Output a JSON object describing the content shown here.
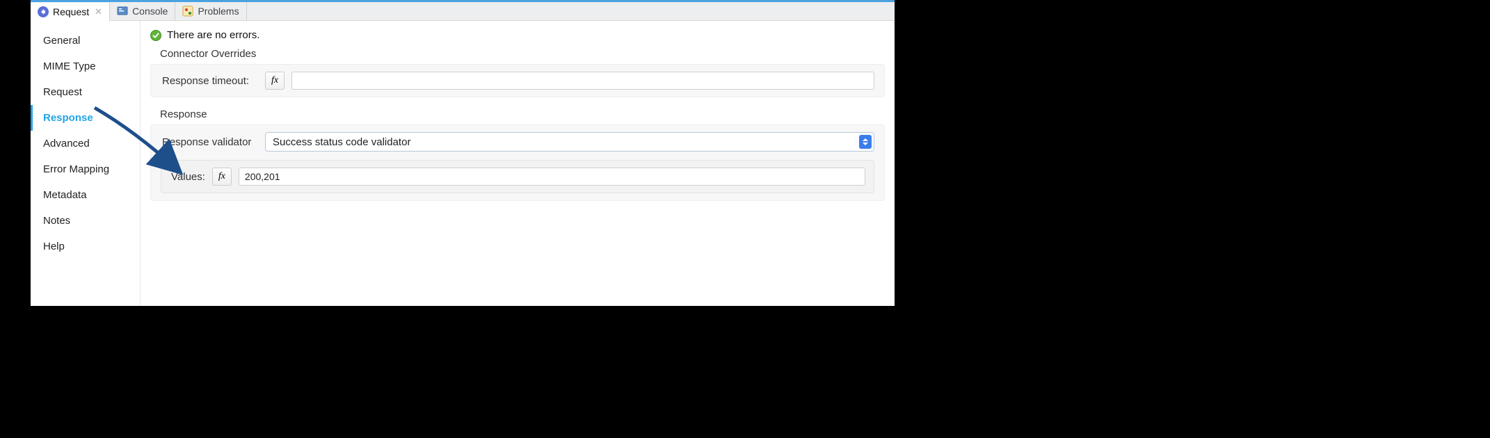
{
  "tabs": [
    {
      "label": "Request",
      "icon": "request-icon",
      "active": true,
      "closable": true
    },
    {
      "label": "Console",
      "icon": "console-icon",
      "active": false,
      "closable": false
    },
    {
      "label": "Problems",
      "icon": "problems-icon",
      "active": false,
      "closable": false
    }
  ],
  "sidebar": {
    "items": [
      {
        "label": "General",
        "selected": false
      },
      {
        "label": "MIME Type",
        "selected": false
      },
      {
        "label": "Request",
        "selected": false
      },
      {
        "label": "Response",
        "selected": true
      },
      {
        "label": "Advanced",
        "selected": false
      },
      {
        "label": "Error Mapping",
        "selected": false
      },
      {
        "label": "Metadata",
        "selected": false
      },
      {
        "label": "Notes",
        "selected": false
      },
      {
        "label": "Help",
        "selected": false
      }
    ]
  },
  "status": {
    "text": "There are no errors."
  },
  "sections": {
    "connector_overrides": {
      "title": "Connector Overrides",
      "fields": {
        "response_timeout_label": "Response timeout:",
        "response_timeout_value": ""
      }
    },
    "response": {
      "title": "Response",
      "validator_label": "Response validator",
      "validator_value": "Success status code validator",
      "values_label": "Values:",
      "values_value": "200,201"
    }
  }
}
